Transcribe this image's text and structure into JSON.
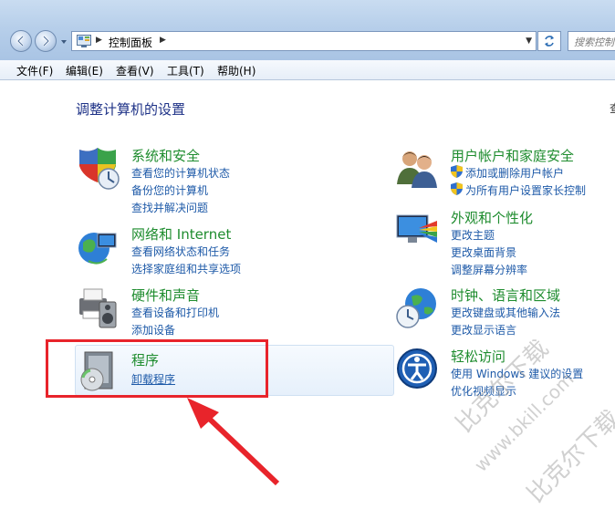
{
  "address": {
    "breadcrumb": "控制面板",
    "search_placeholder": "搜索控制"
  },
  "menu": [
    "文件(F)",
    "编辑(E)",
    "查看(V)",
    "工具(T)",
    "帮助(H)"
  ],
  "heading": "调整计算机的设置",
  "heading_right_cut": "查",
  "categories": {
    "system": {
      "title": "系统和安全",
      "links": [
        "查看您的计算机状态",
        "备份您的计算机",
        "查找并解决问题"
      ]
    },
    "network": {
      "title": "网络和 Internet",
      "links": [
        "查看网络状态和任务",
        "选择家庭组和共享选项"
      ]
    },
    "hardware": {
      "title": "硬件和声音",
      "links": [
        "查看设备和打印机",
        "添加设备"
      ]
    },
    "programs": {
      "title": "程序",
      "links": [
        "卸载程序"
      ]
    },
    "users": {
      "title": "用户帐户和家庭安全",
      "links": [
        "添加或删除用户帐户",
        "为所有用户设置家长控制"
      ]
    },
    "appearance": {
      "title": "外观和个性化",
      "links": [
        "更改主题",
        "更改桌面背景",
        "调整屏幕分辨率"
      ]
    },
    "clock": {
      "title": "时钟、语言和区域",
      "links": [
        "更改键盘或其他输入法",
        "更改显示语言"
      ]
    },
    "ease": {
      "title": "轻松访问",
      "links": [
        "使用 Windows 建议的设置",
        "优化视频显示"
      ]
    }
  },
  "watermark": {
    "line1": "比克尔下载",
    "line2": "www.bkill.com",
    "line3": "比克尔下载"
  },
  "colors": {
    "annotation": "#e8242b",
    "category_title": "#1e8c2e",
    "link": "#1e5aa8"
  }
}
